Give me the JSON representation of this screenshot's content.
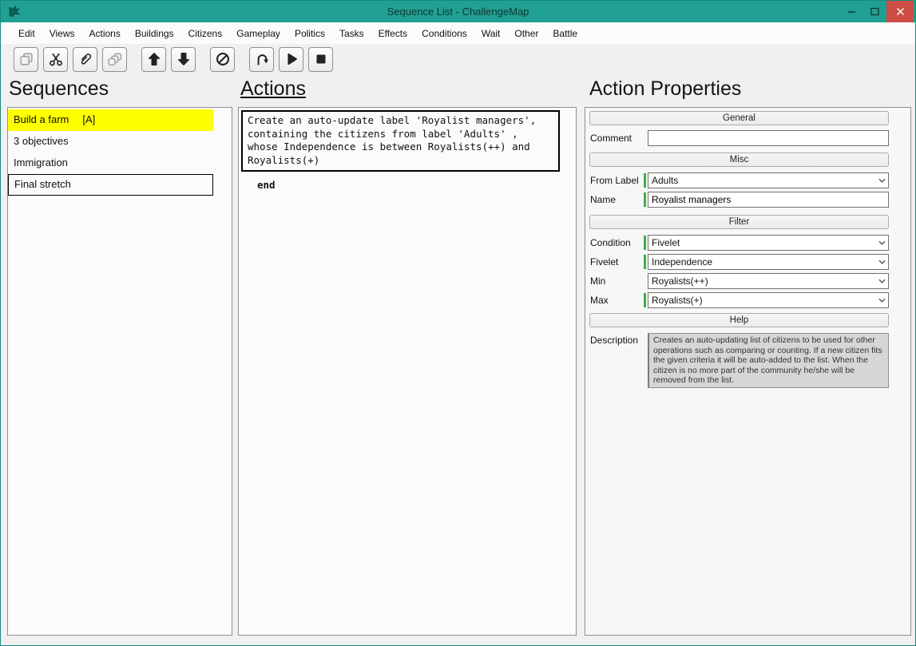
{
  "window": {
    "title": "Sequence List - ChallengeMap"
  },
  "colors": {
    "titlebar_teal": "#20a093",
    "close_red": "#cd4c44",
    "selection_yellow": "#ffff00",
    "modified_green": "#3fae49"
  },
  "menu": {
    "items": [
      "Edit",
      "Views",
      "Actions",
      "Buildings",
      "Citizens",
      "Gameplay",
      "Politics",
      "Tasks",
      "Effects",
      "Conditions",
      "Wait",
      "Other",
      "Battle"
    ]
  },
  "toolbar": {
    "buttons": [
      {
        "name": "copy",
        "icon": "copy-icon",
        "disabled": true
      },
      {
        "name": "cut",
        "icon": "scissors-icon",
        "disabled": false
      },
      {
        "name": "paste",
        "icon": "paperclip-icon",
        "disabled": false
      },
      {
        "name": "duplicate",
        "icon": "clone-icon",
        "disabled": true
      },
      {
        "name": "move-up",
        "icon": "arrow-up-icon",
        "disabled": false
      },
      {
        "name": "move-down",
        "icon": "arrow-down-icon",
        "disabled": false
      },
      {
        "name": "disable",
        "icon": "no-entry-icon",
        "disabled": false
      },
      {
        "name": "undo",
        "icon": "undo-icon",
        "disabled": false
      },
      {
        "name": "run",
        "icon": "play-icon",
        "disabled": false
      },
      {
        "name": "stop",
        "icon": "stop-icon",
        "disabled": false
      }
    ]
  },
  "sequences": {
    "title": "Sequences",
    "items": [
      {
        "label": "Build a farm",
        "badge": "[A]"
      },
      {
        "label": "3 objectives",
        "badge": ""
      },
      {
        "label": "Immigration",
        "badge": ""
      },
      {
        "label": "Final stretch",
        "badge": ""
      }
    ]
  },
  "actions": {
    "title": "Actions",
    "selected_action_text": "Create an auto-update label 'Royalist managers',\ncontaining the citizens from label 'Adults' ,\nwhose Independence is between Royalists(++) and\nRoyalists(+)",
    "end_label": "end"
  },
  "properties": {
    "title": "Action Properties",
    "sections": {
      "general": "General",
      "misc": "Misc",
      "filter": "Filter",
      "help": "Help"
    },
    "fields": {
      "comment": {
        "label": "Comment",
        "value": ""
      },
      "from_label": {
        "label": "From Label",
        "value": "Adults"
      },
      "name": {
        "label": "Name",
        "value": "Royalist managers"
      },
      "condition": {
        "label": "Condition",
        "value": "Fivelet"
      },
      "fivelet": {
        "label": "Fivelet",
        "value": "Independence"
      },
      "min": {
        "label": "Min",
        "value": "Royalists(++)"
      },
      "max": {
        "label": "Max",
        "value": "Royalists(+)"
      },
      "description": {
        "label": "Description",
        "value": "Creates an auto-updating list of citizens to be used for other operations such as comparing or counting. If a new citizen fits the given criteria it will be auto-added to the list. When the citizen is no more part of the community he/she will be removed from the list."
      }
    }
  }
}
